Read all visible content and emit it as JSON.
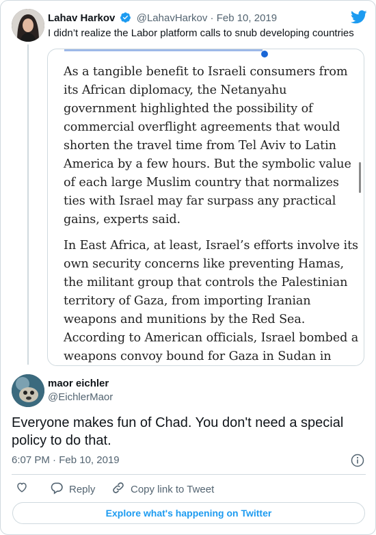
{
  "parent_tweet": {
    "author_name": "Lahav Harkov",
    "verified_icon": "verified-badge-icon",
    "handle": "@LahavHarkov",
    "separator": "·",
    "date": "Feb 10, 2019",
    "text": "I didn’t realize the Labor platform calls to snub developing countries",
    "brand_icon": "twitter-bird-icon",
    "colors": {
      "brand": "#1d9bf0",
      "verified": "#1d9bf0"
    }
  },
  "media": {
    "paragraph1": [
      "As a tangible benefit to Israeli consumers from",
      "its African diplomacy, the Netanyahu",
      "government highlighted the possibility of",
      "commercial overflight agreements that would",
      "shorten the travel time from Tel Aviv to Latin",
      "America by a few hours. But the symbolic value",
      "of each large Muslim country that normalizes",
      "ties with Israel may far surpass any practical",
      "gains, experts said."
    ],
    "paragraph2": [
      "In East Africa, at least, Israel’s efforts involve its",
      "own security concerns like preventing Hamas,",
      "the militant group that controls the Palestinian",
      "territory of Gaza, from importing Iranian",
      "weapons and munitions by the Red Sea.",
      "According to American officials, Israel bombed a",
      "weapons convoy bound for Gaza in Sudan in"
    ]
  },
  "reply_tweet": {
    "author_name": "maor eichler",
    "handle": "@EichlerMaor",
    "text": "Everyone makes fun of Chad. You don't need a special policy to do that.",
    "time": "6:07 PM",
    "separator": "·",
    "date": "Feb 10, 2019",
    "info_icon": "info-icon"
  },
  "actions": {
    "like_icon": "heart-icon",
    "reply_label": "Reply",
    "reply_icon": "reply-bubble-icon",
    "copy_label": "Copy link to Tweet",
    "copy_icon": "link-icon"
  },
  "explore_label": "Explore what's happening on Twitter",
  "colors": {
    "text": "#0f1419",
    "secondary": "#536471",
    "border": "#cfd9de",
    "link": "#1d9bf0"
  }
}
